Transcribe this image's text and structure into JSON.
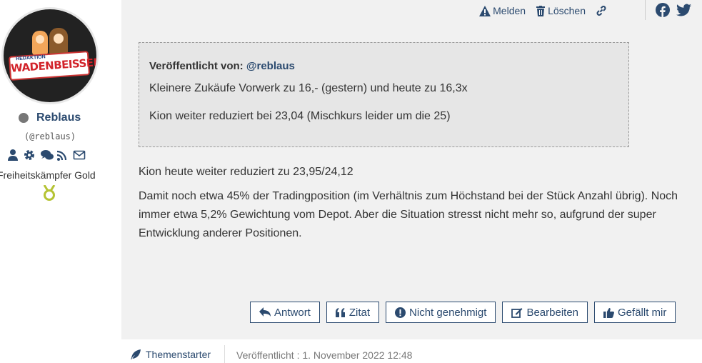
{
  "author": {
    "username": "Reblaus",
    "handle": "(@reblaus)",
    "rank": "Freiheitskämpfer Gold",
    "avatar_text": "WADENBEISSER",
    "avatar_small_text": "REDAKTION",
    "icons": [
      "user-icon",
      "gear-icon",
      "comments-icon",
      "rss-icon",
      "envelope-icon"
    ],
    "colors": {
      "link": "#2b4a6f",
      "medal": "#b5c334"
    }
  },
  "top_actions": {
    "report": "Melden",
    "delete": "Löschen",
    "share_icons": [
      "facebook-icon",
      "twitter-icon"
    ]
  },
  "quote": {
    "by_label": "Veröffentlicht von:",
    "by_user": "@reblaus",
    "line1": "Kleinere Zukäufe Vorwerk zu 16,- (gestern) und heute zu 16,3x",
    "line2": "Kion weiter reduziert bei 23,04 (Mischkurs leider um die 25)"
  },
  "body": {
    "p1": "Kion heute weiter reduziert zu 23,95/24,12",
    "p2": "Damit noch etwa 45% der Tradingposition (im Verhältnis zum Höchstand bei der Stück Anzahl übrig). Noch immer etwa 5,2% Gewichtung vom Depot. Aber die Situation stresst nicht mehr so, aufgrund der super Entwicklung anderer Positionen."
  },
  "buttons": {
    "reply": "Antwort",
    "quote": "Zitat",
    "unapprove": "Nicht genehmigt",
    "edit": "Bearbeiten",
    "like": "Gefällt mir"
  },
  "footer": {
    "starter": "Themenstarter",
    "published": "Veröffentlicht : 1. November 2022 12:48"
  }
}
